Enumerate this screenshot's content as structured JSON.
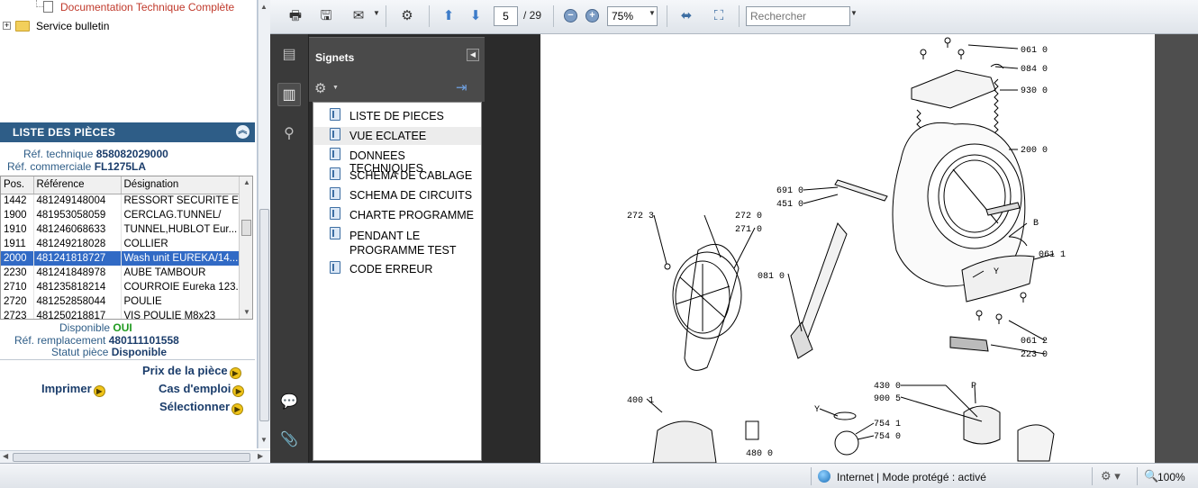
{
  "tree": {
    "doc_link": "Documentation Technique Complète",
    "folder_label": "Service bulletin"
  },
  "parts_panel": {
    "title": "LISTE DES PIÈCES",
    "ref_tech_label": "Réf. technique",
    "ref_tech_value": "858082029000",
    "ref_com_label": "Réf. commerciale",
    "ref_com_value": "FL1275LA",
    "columns": [
      "Pos.",
      "Référence",
      "Désignation"
    ],
    "rows": [
      {
        "pos": "1442",
        "ref": "481249148004",
        "des": "RESSORT SECURITE E..."
      },
      {
        "pos": "1900",
        "ref": "481953058059",
        "des": "CERCLAG.TUNNEL/"
      },
      {
        "pos": "1910",
        "ref": "481246068633",
        "des": "TUNNEL,HUBLOT Eur..."
      },
      {
        "pos": "1911",
        "ref": "481249218028",
        "des": "COLLIER"
      },
      {
        "pos": "2000",
        "ref": "481241818727",
        "des": "Wash unit EUREKA/14..."
      },
      {
        "pos": "2230",
        "ref": "481241848978",
        "des": "AUBE TAMBOUR"
      },
      {
        "pos": "2710",
        "ref": "481235818214",
        "des": "COURROIE Eureka 123..."
      },
      {
        "pos": "2720",
        "ref": "481252858044",
        "des": "POULIE"
      },
      {
        "pos": "2723",
        "ref": "481250218817",
        "des": "VIS POULIE M8x23"
      }
    ],
    "selected_row": 4,
    "disponible_label": "Disponible",
    "disponible_value": "OUI",
    "remplacement_label": "Réf. remplacement",
    "remplacement_value": "480111101558",
    "statut_label": "Statut pièce",
    "statut_value": "Disponible",
    "actions": {
      "prix": "Prix de la pièce",
      "imprimer": "Imprimer",
      "cas": "Cas d'emploi",
      "selectionner": "Sélectionner"
    }
  },
  "toolbar": {
    "page_current": "5",
    "page_total": "/ 29",
    "zoom": "75%",
    "search_placeholder": "Rechercher"
  },
  "bookmarks": {
    "title": "Signets",
    "items": [
      "LISTE DE PIECES",
      "VUE ECLATEE",
      "DONNEES TECHNIQUES",
      "SCHEMA DE CABLAGE",
      "SCHEMA DE CIRCUITS",
      "CHARTE PROGRAMME",
      "PENDANT LE PROGRAMME TEST",
      "CODE ERREUR"
    ],
    "highlighted": 1
  },
  "diagram_labels": {
    "l061_0": "061 0",
    "l084_0": "084 0",
    "l930_0": "930 0",
    "l200_0": "200 0",
    "l691_0": "691 0",
    "l451_0": "451 0",
    "l272_3": "272 3",
    "l272_0": "272 0",
    "l271_0": "271 0",
    "lB": "B",
    "l061_1": "061 1",
    "lY": "Y",
    "l081_0": "081 0",
    "l061_2": "061 2",
    "l223_0": "223 0",
    "l430_0": "430 0",
    "l900_5": "900 5",
    "lP": "P",
    "l400_1": "400 1",
    "lY2": "Y",
    "l754_1": "754 1",
    "l754_0": "754 0",
    "l480_0": "480 0"
  },
  "statusbar": {
    "zone": "Internet | Mode protégé : activé",
    "zoom": "100%"
  }
}
